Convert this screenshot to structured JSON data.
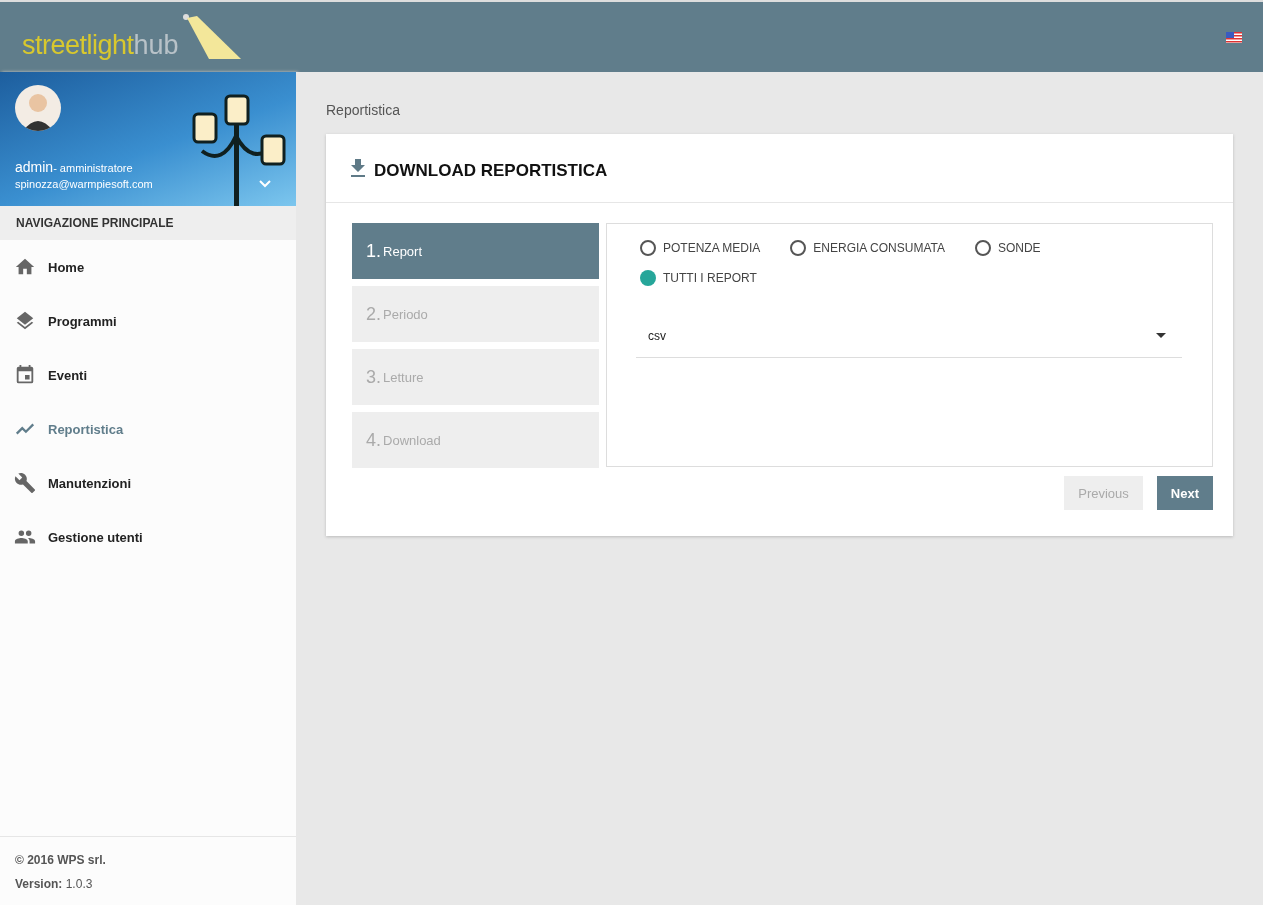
{
  "header": {
    "logo": {
      "part_1": "streetlight",
      "part_2": "hub"
    }
  },
  "sidebar": {
    "user": {
      "name": "admin",
      "role": "- amministratore",
      "email": "spinozza@warmpiesoft.com"
    },
    "nav_title": "NAVIGAZIONE PRINCIPALE",
    "items": [
      {
        "label": "Home",
        "kind": "home",
        "selected": false
      },
      {
        "label": "Programmi",
        "kind": "layers",
        "selected": false
      },
      {
        "label": "Eventi",
        "kind": "calendar",
        "selected": false
      },
      {
        "label": "Reportistica",
        "kind": "chart",
        "selected": true
      },
      {
        "label": "Manutenzioni",
        "kind": "wrench",
        "selected": false
      },
      {
        "label": "Gestione utenti",
        "kind": "people",
        "selected": false
      }
    ],
    "footer": {
      "copyright": "© 2016 WPS srl.",
      "version": "**Version:** 1.0.3"
    }
  },
  "breadcrumb": "Reportistica",
  "card": {
    "title": "DOWNLOAD REPORTISTICA",
    "steps": [
      {
        "number": "1.",
        "label": "Report",
        "selected": true
      },
      {
        "number": "2.",
        "label": "Periodo",
        "selected": false
      },
      {
        "number": "3.",
        "label": "Letture",
        "selected": false
      },
      {
        "number": "4.",
        "label": "Download",
        "selected": false
      }
    ],
    "options": [
      {
        "label": "POTENZA MEDIA",
        "selected": false
      },
      {
        "label": "ENERGIA CONSUMATA",
        "selected": false
      },
      {
        "label": "SONDE",
        "selected": false
      },
      {
        "label": "TUTTI I REPORT",
        "selected": true
      }
    ],
    "format": "csv",
    "buttons": [
      {
        "label": "Previous",
        "disabled": true
      },
      {
        "label": "Next",
        "disabled": false
      }
    ]
  }
}
